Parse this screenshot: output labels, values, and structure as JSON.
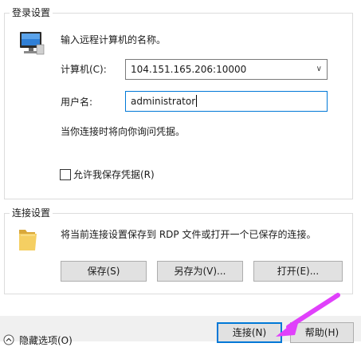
{
  "login_settings": {
    "title": "登录设置",
    "instruction": "输入远程计算机的名称。",
    "computer_label": "计算机(C):",
    "computer_value": "104.151.165.206:10000",
    "username_label": "用户名:",
    "username_value": "administrator",
    "credential_note": "当你连接时将向你询问凭据。",
    "allow_save_label": "允许我保存凭据(R)",
    "allow_save_checked": false
  },
  "connection_settings": {
    "title": "连接设置",
    "description": "将当前连接设置保存到 RDP 文件或打开一个已保存的连接。",
    "save_label": "保存(S)",
    "save_as_label": "另存为(V)...",
    "open_label": "打开(E)..."
  },
  "footer": {
    "hide_options_label": "隐藏选项(O)",
    "connect_label": "连接(N)",
    "help_label": "帮助(H)"
  },
  "annotation": {
    "arrow_color": "#e040fb"
  }
}
